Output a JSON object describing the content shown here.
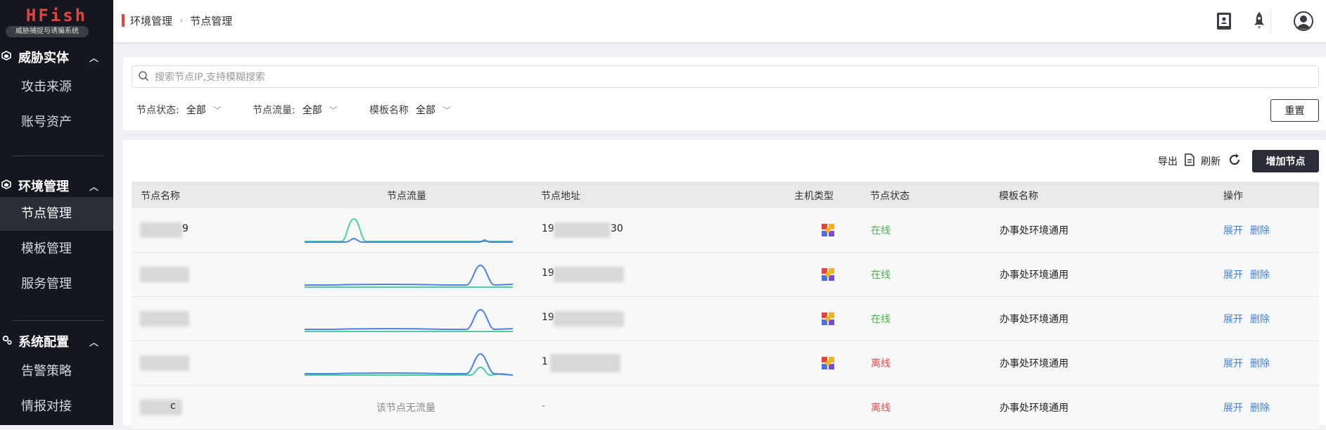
{
  "app": {
    "logo_title": "HFish",
    "logo_subtitle": "威胁捕捉与诱骗系统"
  },
  "sidebar": {
    "groups": [
      {
        "label": "威胁实体",
        "icon": "cube-icon",
        "items": [
          "攻击来源",
          "账号资产"
        ]
      },
      {
        "label": "环境管理",
        "icon": "cube-icon",
        "items": [
          "节点管理",
          "模板管理",
          "服务管理"
        ],
        "active": "节点管理"
      },
      {
        "label": "系统配置",
        "icon": "gear-icon",
        "items": [
          "告警策略",
          "情报对接"
        ]
      }
    ]
  },
  "header": {
    "breadcrumb": [
      "环境管理",
      "节点管理"
    ],
    "icons": [
      "notebook-icon",
      "rocket-icon",
      "user-avatar-icon"
    ]
  },
  "search": {
    "placeholder": "搜索节点IP,支持模糊搜索",
    "value": ""
  },
  "filters": [
    {
      "label": "节点状态:",
      "value": "全部"
    },
    {
      "label": "节点流量:",
      "value": "全部"
    },
    {
      "label": "模板名称",
      "value": "全部"
    }
  ],
  "reset_label": "重置",
  "toolbar": {
    "export_label": "导出",
    "refresh_label": "刷新",
    "add_label": "增加节点"
  },
  "table": {
    "columns": [
      "节点名称",
      "节点流量",
      "节点地址",
      "主机类型",
      "节点状态",
      "模板名称",
      "操作"
    ],
    "rows": [
      {
        "name_visible": "9",
        "address_prefix": "19",
        "address_suffix": "30",
        "status": "在线",
        "template": "办事处环境通用",
        "traffic": "spike-left"
      },
      {
        "name_visible": "",
        "address_prefix": "19",
        "address_suffix": "",
        "status": "在线",
        "template": "办事处环境通用",
        "traffic": "spike-right"
      },
      {
        "name_visible": "",
        "address_prefix": "19",
        "address_suffix": "",
        "status": "在线",
        "template": "办事处环境通用",
        "traffic": "spike-right"
      },
      {
        "name_visible": "",
        "address_prefix": "1",
        "address_suffix": "",
        "status": "离线",
        "template": "办事处环境通用",
        "traffic": "spike-right-both"
      },
      {
        "name_visible": "c",
        "address_prefix": "-",
        "address_suffix": "",
        "status": "离线",
        "template": "办事处环境通用",
        "traffic": "none",
        "traffic_text": "该节点无流量"
      }
    ],
    "actions": [
      "展开",
      "删除"
    ]
  },
  "colors": {
    "sidebar_bg": "#14171f",
    "brand_red": "#e8423f",
    "online_green": "#4caf50",
    "offline_red": "#e04848",
    "link_blue": "#3d7fe0",
    "line_blue": "#4a80e8",
    "line_green": "#4ccfa0"
  }
}
